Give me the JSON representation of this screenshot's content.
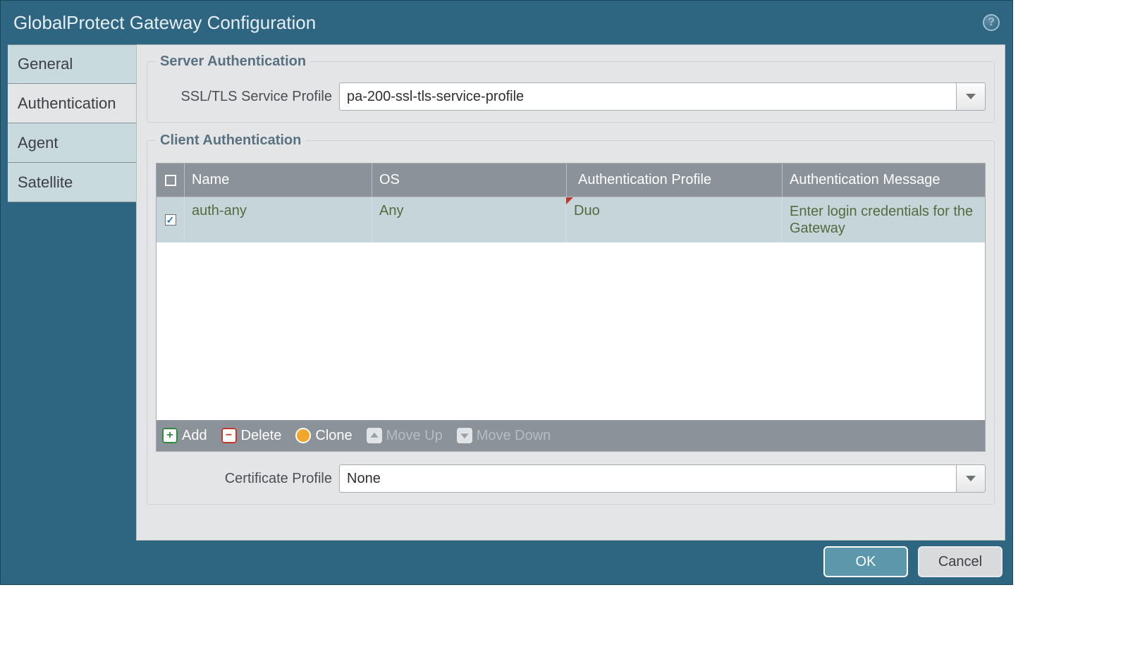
{
  "title": "GlobalProtect Gateway Configuration",
  "tabs": [
    {
      "label": "General"
    },
    {
      "label": "Authentication"
    },
    {
      "label": "Agent"
    },
    {
      "label": "Satellite"
    }
  ],
  "server_auth": {
    "legend": "Server Authentication",
    "ssl_label": "SSL/TLS Service Profile",
    "ssl_value": "pa-200-ssl-tls-service-profile"
  },
  "client_auth": {
    "legend": "Client Authentication",
    "columns": {
      "name": "Name",
      "os": "OS",
      "auth_profile": "Authentication Profile",
      "auth_message": "Authentication Message"
    },
    "rows": [
      {
        "checked": true,
        "name": "auth-any",
        "os": "Any",
        "auth_profile": "Duo",
        "auth_message": "Enter login credentials for the Gateway"
      }
    ],
    "toolbar": {
      "add": "Add",
      "delete": "Delete",
      "clone": "Clone",
      "move_up": "Move Up",
      "move_down": "Move Down"
    },
    "cert_label": "Certificate Profile",
    "cert_value": "None"
  },
  "buttons": {
    "ok": "OK",
    "cancel": "Cancel"
  }
}
